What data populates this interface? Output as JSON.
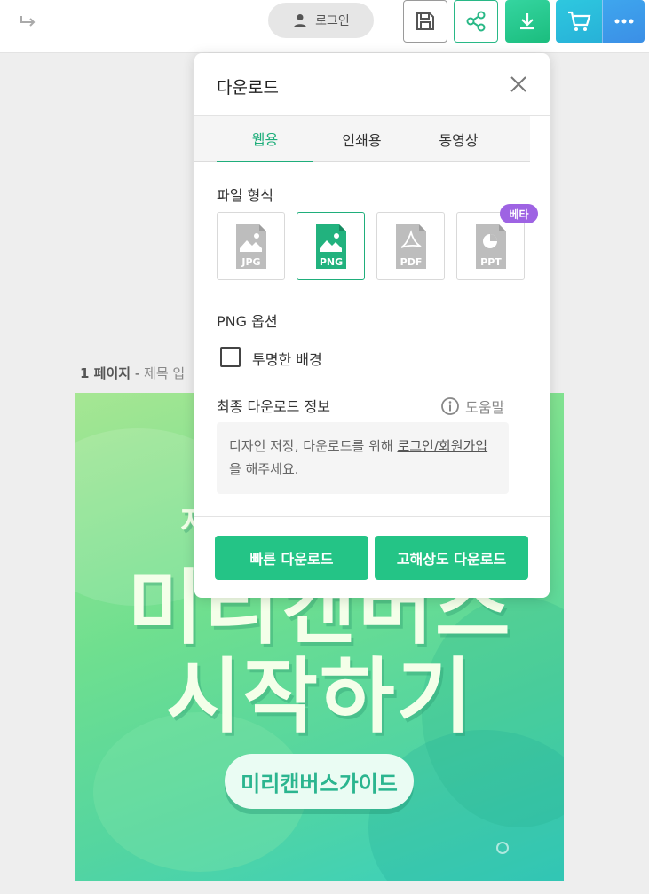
{
  "topbar": {
    "login_label": "로그인"
  },
  "page": {
    "label_number": "1 페이지",
    "label_sep": " - ",
    "label_title": "제목 입"
  },
  "canvas": {
    "headline_small": "지",
    "headline_line1": "미리캔버스",
    "headline_line2": "시작하기",
    "guide_button": "미리캔버스가이드"
  },
  "dialog": {
    "title": "다운로드",
    "tabs": [
      {
        "label": "웹용",
        "active": true
      },
      {
        "label": "인쇄용",
        "active": false
      },
      {
        "label": "동영상",
        "active": false
      }
    ],
    "file_format_label": "파일 형식",
    "formats": [
      {
        "label": "JPG",
        "selected": false
      },
      {
        "label": "PNG",
        "selected": true
      },
      {
        "label": "PDF",
        "selected": false
      },
      {
        "label": "PPT",
        "selected": false
      }
    ],
    "beta_badge": "베타",
    "png_options_label": "PNG 옵션",
    "transparent_bg_label": "투명한 배경",
    "transparent_bg_checked": false,
    "final_info_label": "최종 다운로드 정보",
    "help_label": "도움말",
    "info_text_before": "디자인 저장, 다운로드를 위해 ",
    "info_link": "로그인/회원가입",
    "info_text_after": "을 해주세요.",
    "quick_download": "빠른 다운로드",
    "hq_download": "고해상도 다운로드"
  },
  "colors": {
    "accent": "#1fae7b",
    "button": "#24c486",
    "beta": "#9e63e3"
  }
}
